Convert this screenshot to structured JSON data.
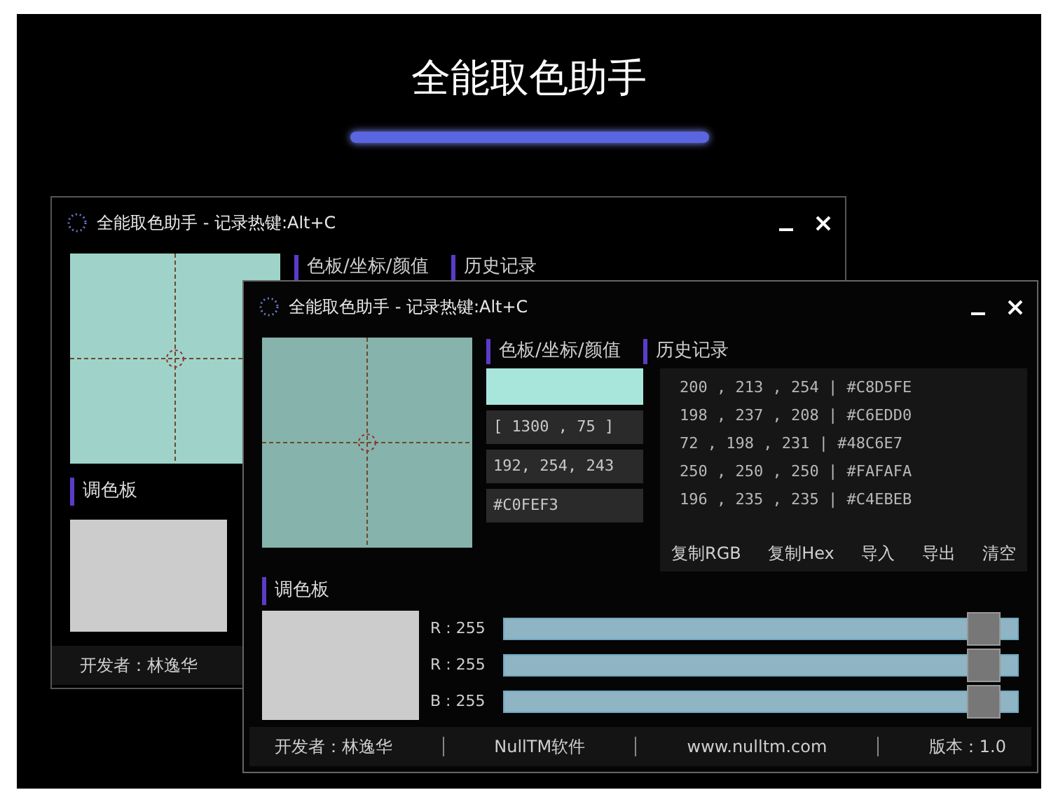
{
  "page_title": "全能取色助手",
  "windows": [
    {
      "kind": "back",
      "title": "全能取色助手 - 记录热键:Alt+C",
      "tabs": [
        {
          "label": "色板/坐标/颜值"
        },
        {
          "label": "历史记录"
        }
      ],
      "palette_label": "调色板",
      "footer": [
        "开发者：林逸华"
      ]
    },
    {
      "kind": "front",
      "title": "全能取色助手 - 记录热键:Alt+C",
      "tabs": [
        {
          "label": "色板/坐标/颜值"
        },
        {
          "label": "历史记录"
        }
      ],
      "fields": [
        "[ 1300 , 75 ]",
        "192, 254, 243",
        "#C0FEF3"
      ],
      "history": [
        "200 , 213 , 254 | #C8D5FE",
        "198 , 237 , 208 | #C6EDD0",
        "72 , 198 , 231 | #48C6E7",
        "250 , 250 , 250 | #FAFAFA",
        "196 , 235 , 235 | #C4EBEB"
      ],
      "history_buttons": [
        "复制RGB",
        "复制Hex",
        "导入",
        "导出",
        "清空"
      ],
      "palette_label": "调色板",
      "sliders": [
        {
          "label": "R : 255",
          "level": 1
        },
        {
          "label": "R : 255",
          "level": 1
        },
        {
          "label": "B : 255",
          "level": 1
        }
      ],
      "footer": [
        "开发者：林逸华",
        "NullTM软件",
        "www.nulltm.com",
        "版本：1.0"
      ]
    }
  ]
}
